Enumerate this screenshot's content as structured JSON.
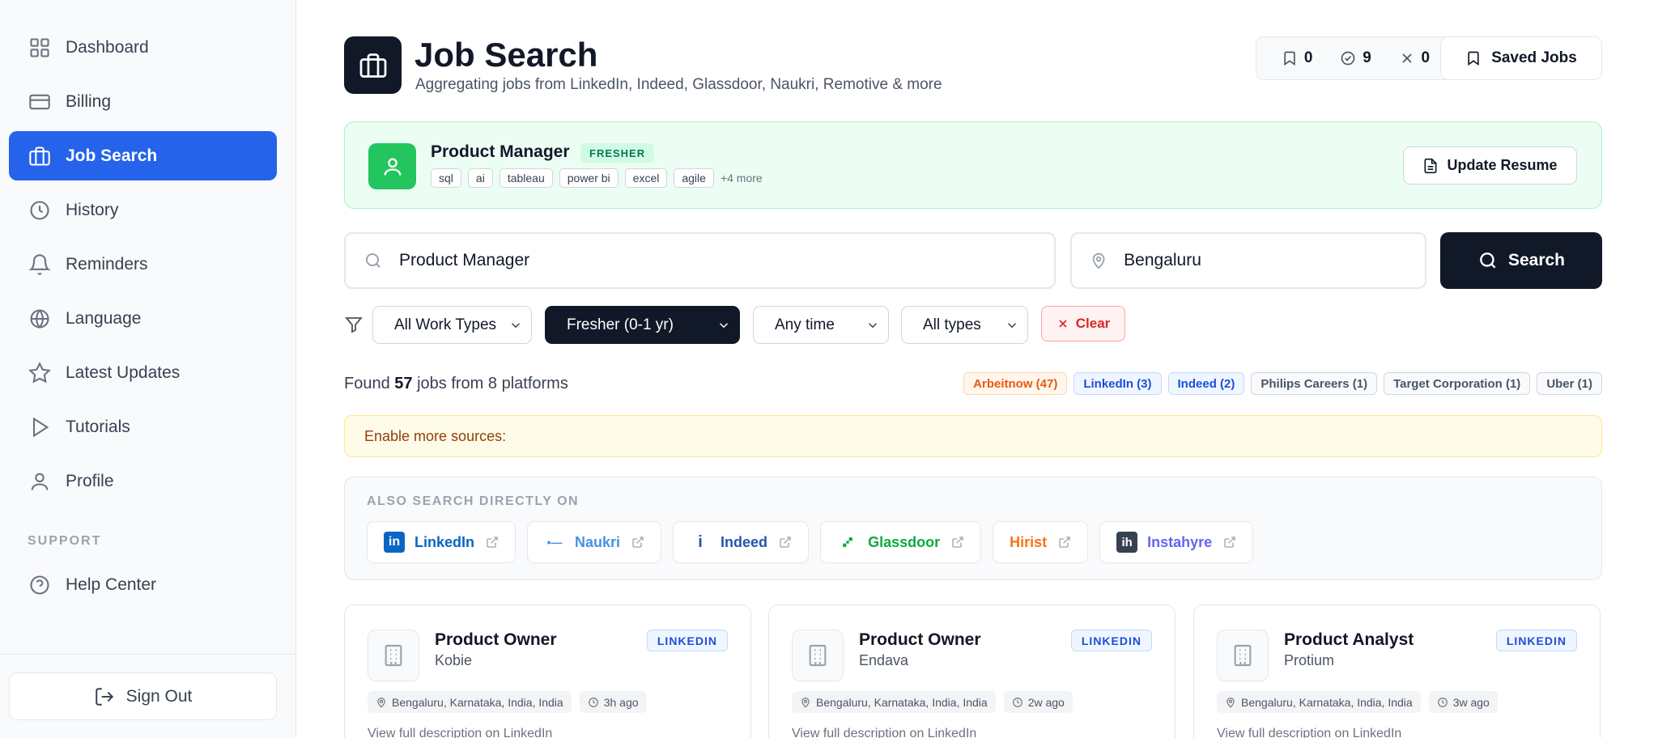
{
  "sidebar": {
    "items": [
      {
        "label": "Dashboard",
        "icon": "dashboard-icon"
      },
      {
        "label": "Billing",
        "icon": "credit-card-icon"
      },
      {
        "label": "Job Search",
        "icon": "briefcase-icon",
        "active": true
      },
      {
        "label": "History",
        "icon": "clock-icon"
      },
      {
        "label": "Reminders",
        "icon": "bell-icon"
      },
      {
        "label": "Language",
        "icon": "globe-icon"
      },
      {
        "label": "Latest Updates",
        "icon": "star-icon"
      },
      {
        "label": "Tutorials",
        "icon": "play-icon"
      },
      {
        "label": "Profile",
        "icon": "user-icon"
      }
    ],
    "support_label": "SUPPORT",
    "help_center": "Help Center",
    "sign_out": "Sign Out"
  },
  "header": {
    "title": "Job Search",
    "subtitle": "Aggregating jobs from LinkedIn, Indeed, Glassdoor, Naukri, Remotive & more",
    "counters": {
      "saved": "0",
      "applied": "9",
      "rejected": "0"
    },
    "saved_jobs_label": "Saved Jobs"
  },
  "profile": {
    "role": "Product Manager",
    "level_badge": "FRESHER",
    "skills": [
      "sql",
      "ai",
      "tableau",
      "power bi",
      "excel",
      "agile"
    ],
    "more_skills": "+4 more",
    "update_resume_label": "Update Resume"
  },
  "search": {
    "query": "Product Manager",
    "location": "Bengaluru",
    "button_label": "Search"
  },
  "filters": {
    "work_type": "All Work Types",
    "experience": "Fresher (0-1 yr)",
    "date_posted": "Any time",
    "job_type": "All types",
    "clear_label": "Clear"
  },
  "results": {
    "found_prefix": "Found",
    "count": "57",
    "found_suffix": "jobs from 8 platforms",
    "sources": [
      {
        "label": "Arbeitnow (47)",
        "style": "orange"
      },
      {
        "label": "LinkedIn (3)",
        "style": "blue"
      },
      {
        "label": "Indeed (2)",
        "style": "blue"
      },
      {
        "label": "Philips Careers (1)",
        "style": "gray"
      },
      {
        "label": "Target Corporation (1)",
        "style": "gray"
      },
      {
        "label": "Uber (1)",
        "style": "gray"
      }
    ]
  },
  "enable_banner": "Enable more sources:",
  "also_search": {
    "label": "ALSO SEARCH DIRECTLY ON",
    "portals": [
      {
        "name": "LinkedIn",
        "color": "#0a66c2"
      },
      {
        "name": "Naukri",
        "color": "#4a90e2"
      },
      {
        "name": "Indeed",
        "color": "#2557a7"
      },
      {
        "name": "Glassdoor",
        "color": "#0caa41"
      },
      {
        "name": "Hirist",
        "color": "#f97316"
      },
      {
        "name": "Instahyre",
        "color": "#6366f1"
      }
    ]
  },
  "jobs": [
    {
      "title": "Product Owner",
      "company": "Kobie",
      "source": "LINKEDIN",
      "location": "Bengaluru, Karnataka, India, India",
      "posted": "3h ago",
      "description": "View full description on LinkedIn"
    },
    {
      "title": "Product Owner",
      "company": "Endava",
      "source": "LINKEDIN",
      "location": "Bengaluru, Karnataka, India, India",
      "posted": "2w ago",
      "description": "View full description on LinkedIn"
    },
    {
      "title": "Product Analyst",
      "company": "Protium",
      "source": "LINKEDIN",
      "location": "Bengaluru, Karnataka, India, India",
      "posted": "3w ago",
      "description": "View full description on LinkedIn"
    }
  ]
}
